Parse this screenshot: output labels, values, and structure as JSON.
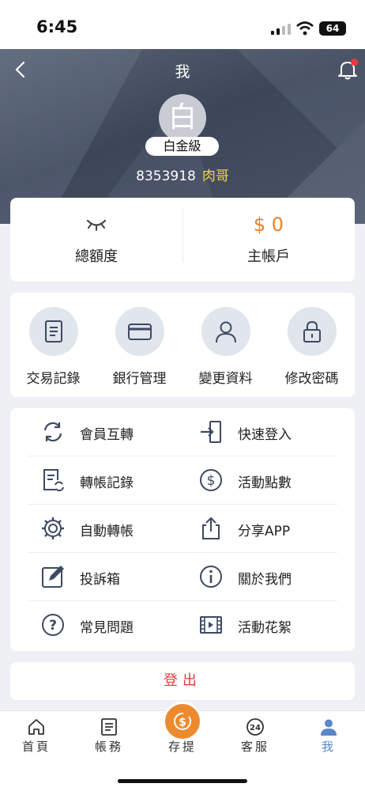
{
  "status_bar": {
    "time": "6:45",
    "battery": "64"
  },
  "header": {
    "title": "我",
    "avatar_char": "白",
    "level": "白金級",
    "user_id": "8353918",
    "nickname": "肉哥"
  },
  "balance": {
    "left_label": "總額度",
    "right_amount": "$ 0",
    "right_label": "主帳戶",
    "accent_color": "#e9822b"
  },
  "quick_actions": [
    {
      "label": "交易記錄",
      "icon": "document-list-icon"
    },
    {
      "label": "銀行管理",
      "icon": "bank-card-icon"
    },
    {
      "label": "變更資料",
      "icon": "user-icon"
    },
    {
      "label": "修改密碼",
      "icon": "lock-icon"
    }
  ],
  "menu": [
    {
      "label": "會員互轉",
      "icon": "refresh-icon"
    },
    {
      "label": "快速登入",
      "icon": "login-icon"
    },
    {
      "label": "轉帳記錄",
      "icon": "transfer-record-icon"
    },
    {
      "label": "活動點數",
      "icon": "dollar-circle-icon"
    },
    {
      "label": "自動轉帳",
      "icon": "gear-icon"
    },
    {
      "label": "分享APP",
      "icon": "share-icon"
    },
    {
      "label": "投訴箱",
      "icon": "edit-icon"
    },
    {
      "label": "關於我們",
      "icon": "info-icon"
    },
    {
      "label": "常見問題",
      "icon": "question-icon"
    },
    {
      "label": "活動花絮",
      "icon": "film-icon"
    }
  ],
  "logout": {
    "label": "登出"
  },
  "tabbar": [
    {
      "label": "首頁",
      "icon": "home-icon"
    },
    {
      "label": "帳務",
      "icon": "ledger-icon"
    },
    {
      "label": "存提",
      "icon": "deposit-icon"
    },
    {
      "label": "客服",
      "icon": "support-24-icon"
    },
    {
      "label": "我",
      "icon": "profile-icon",
      "active": true
    }
  ],
  "colors": {
    "active_tab": "#5b86c8",
    "logout": "#e23d3d",
    "nickname": "#f3d83b",
    "fab": "#ee8a2e"
  }
}
